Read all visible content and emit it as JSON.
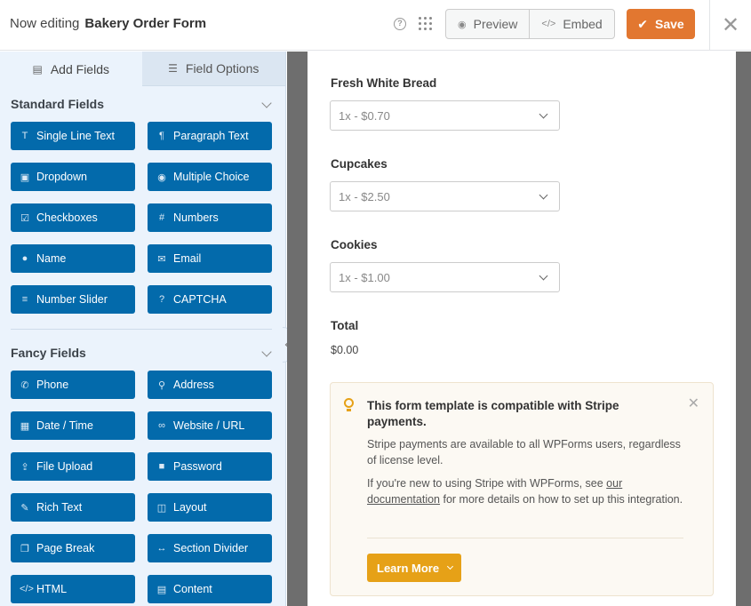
{
  "header": {
    "prefix": "Now editing",
    "form_name": "Bakery Order Form",
    "help_icon": "help-icon",
    "apps_icon": "grid-icon",
    "preview_label": "Preview",
    "embed_label": "Embed",
    "save_label": "Save",
    "close_icon": "close-icon"
  },
  "sidebar": {
    "tabs": [
      {
        "label": "Add Fields",
        "icon": "list-icon"
      },
      {
        "label": "Field Options",
        "icon": "sliders-icon"
      }
    ],
    "sections": [
      {
        "title": "Standard Fields",
        "fields": [
          {
            "label": "Single Line Text",
            "icon": "text-icon"
          },
          {
            "label": "Paragraph Text",
            "icon": "paragraph-icon"
          },
          {
            "label": "Dropdown",
            "icon": "dropdown-icon"
          },
          {
            "label": "Multiple Choice",
            "icon": "radio-icon"
          },
          {
            "label": "Checkboxes",
            "icon": "checkbox-icon"
          },
          {
            "label": "Numbers",
            "icon": "hash-icon"
          },
          {
            "label": "Name",
            "icon": "user-icon"
          },
          {
            "label": "Email",
            "icon": "envelope-icon"
          },
          {
            "label": "Number Slider",
            "icon": "sliders-icon"
          },
          {
            "label": "CAPTCHA",
            "icon": "question-icon"
          }
        ]
      },
      {
        "title": "Fancy Fields",
        "fields": [
          {
            "label": "Phone",
            "icon": "phone-icon"
          },
          {
            "label": "Address",
            "icon": "map-pin-icon"
          },
          {
            "label": "Date / Time",
            "icon": "calendar-icon"
          },
          {
            "label": "Website / URL",
            "icon": "link-icon"
          },
          {
            "label": "File Upload",
            "icon": "upload-icon"
          },
          {
            "label": "Password",
            "icon": "lock-icon"
          },
          {
            "label": "Rich Text",
            "icon": "edit-icon"
          },
          {
            "label": "Layout",
            "icon": "columns-icon"
          },
          {
            "label": "Page Break",
            "icon": "copy-icon"
          },
          {
            "label": "Section Divider",
            "icon": "arrows-h-icon"
          },
          {
            "label": "HTML",
            "icon": "code-icon"
          },
          {
            "label": "Content",
            "icon": "file-icon"
          }
        ]
      }
    ]
  },
  "form": {
    "items": [
      {
        "label": "Fresh White Bread",
        "value": "1x - $0.70"
      },
      {
        "label": "Cupcakes",
        "value": "1x - $2.50"
      },
      {
        "label": "Cookies",
        "value": "1x - $1.00"
      }
    ],
    "total_label": "Total",
    "total_value": "$0.00"
  },
  "notice": {
    "title": "This form template is compatible with Stripe payments.",
    "p1": "Stripe payments are available to all WPForms users, regardless of license level.",
    "p2_a": "If you're new to using Stripe with WPForms, see",
    "p2_link1": "our",
    "p2_link2": "documentation",
    "p2_b": "for more details on how to set up this integration.",
    "button_label": "Learn More"
  },
  "colors": {
    "accent_orange": "#e27730",
    "field_button_blue": "#036aab",
    "learn_more_yellow": "#e6a117",
    "sidebar_bg": "#ebf3fc"
  }
}
